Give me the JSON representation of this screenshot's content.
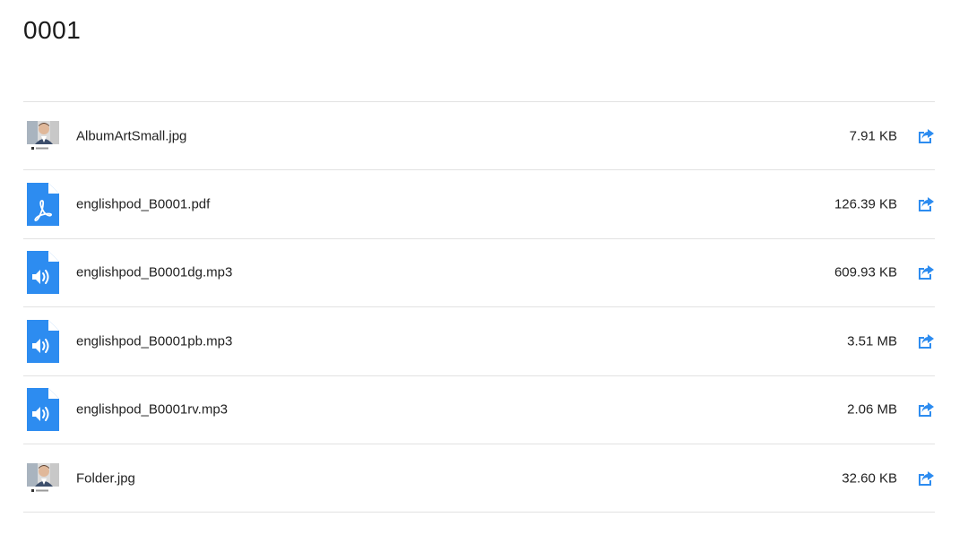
{
  "page": {
    "title": "0001"
  },
  "colors": {
    "accent": "#2d8cf0",
    "divider": "#e2e2e2",
    "text": "#222222"
  },
  "files": [
    {
      "name": "AlbumArtSmall.jpg",
      "size": "7.91 KB",
      "icon": "image-thumbnail"
    },
    {
      "name": "englishpod_B0001.pdf",
      "size": "126.39 KB",
      "icon": "pdf-file-icon"
    },
    {
      "name": "englishpod_B0001dg.mp3",
      "size": "609.93 KB",
      "icon": "audio-file-icon"
    },
    {
      "name": "englishpod_B0001pb.mp3",
      "size": "3.51 MB",
      "icon": "audio-file-icon"
    },
    {
      "name": "englishpod_B0001rv.mp3",
      "size": "2.06 MB",
      "icon": "audio-file-icon"
    },
    {
      "name": "Folder.jpg",
      "size": "32.60 KB",
      "icon": "image-thumbnail"
    }
  ],
  "share_icon": "share-icon"
}
